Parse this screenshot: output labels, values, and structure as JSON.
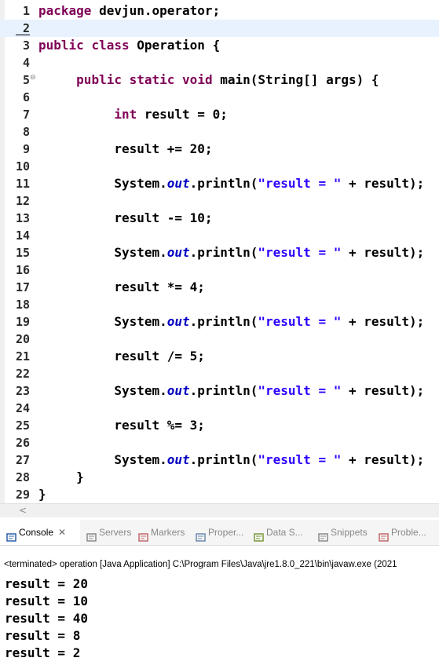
{
  "editor": {
    "lines": [
      {
        "n": "1",
        "parts": [
          {
            "t": "package",
            "c": "kw"
          },
          {
            "t": " devjun.operator;"
          }
        ]
      },
      {
        "n": "2",
        "parts": [],
        "current": true
      },
      {
        "n": "3",
        "parts": [
          {
            "t": "public",
            "c": "kw"
          },
          {
            "t": " "
          },
          {
            "t": "class",
            "c": "kw"
          },
          {
            "t": " Operation {"
          }
        ]
      },
      {
        "n": "4",
        "parts": []
      },
      {
        "n": "5",
        "fold": "⊖",
        "parts": [
          {
            "t": "     "
          },
          {
            "t": "public",
            "c": "kw"
          },
          {
            "t": " "
          },
          {
            "t": "static",
            "c": "kw"
          },
          {
            "t": " "
          },
          {
            "t": "void",
            "c": "kw"
          },
          {
            "t": " main(String[] args) {"
          }
        ]
      },
      {
        "n": "6",
        "parts": []
      },
      {
        "n": "7",
        "parts": [
          {
            "t": "          "
          },
          {
            "t": "int",
            "c": "kw"
          },
          {
            "t": " result = 0;"
          }
        ]
      },
      {
        "n": "8",
        "parts": []
      },
      {
        "n": "9",
        "parts": [
          {
            "t": "          result += 20;"
          }
        ]
      },
      {
        "n": "10",
        "parts": []
      },
      {
        "n": "11",
        "parts": [
          {
            "t": "          System."
          },
          {
            "t": "out",
            "c": "fld"
          },
          {
            "t": ".println("
          },
          {
            "t": "\"result = \"",
            "c": "str"
          },
          {
            "t": " + result);"
          }
        ]
      },
      {
        "n": "12",
        "parts": []
      },
      {
        "n": "13",
        "parts": [
          {
            "t": "          result -= 10;"
          }
        ]
      },
      {
        "n": "14",
        "parts": []
      },
      {
        "n": "15",
        "parts": [
          {
            "t": "          System."
          },
          {
            "t": "out",
            "c": "fld"
          },
          {
            "t": ".println("
          },
          {
            "t": "\"result = \"",
            "c": "str"
          },
          {
            "t": " + result);"
          }
        ]
      },
      {
        "n": "16",
        "parts": []
      },
      {
        "n": "17",
        "parts": [
          {
            "t": "          result *= 4;"
          }
        ]
      },
      {
        "n": "18",
        "parts": []
      },
      {
        "n": "19",
        "parts": [
          {
            "t": "          System."
          },
          {
            "t": "out",
            "c": "fld"
          },
          {
            "t": ".println("
          },
          {
            "t": "\"result = \"",
            "c": "str"
          },
          {
            "t": " + result);"
          }
        ]
      },
      {
        "n": "20",
        "parts": []
      },
      {
        "n": "21",
        "parts": [
          {
            "t": "          result /= 5;"
          }
        ]
      },
      {
        "n": "22",
        "parts": []
      },
      {
        "n": "23",
        "parts": [
          {
            "t": "          System."
          },
          {
            "t": "out",
            "c": "fld"
          },
          {
            "t": ".println("
          },
          {
            "t": "\"result = \"",
            "c": "str"
          },
          {
            "t": " + result);"
          }
        ]
      },
      {
        "n": "24",
        "parts": []
      },
      {
        "n": "25",
        "parts": [
          {
            "t": "          result %= 3;"
          }
        ]
      },
      {
        "n": "26",
        "parts": []
      },
      {
        "n": "27",
        "parts": [
          {
            "t": "          System."
          },
          {
            "t": "out",
            "c": "fld"
          },
          {
            "t": ".println("
          },
          {
            "t": "\"result = \"",
            "c": "str"
          },
          {
            "t": " + result);"
          }
        ]
      },
      {
        "n": "28",
        "parts": [
          {
            "t": "     }"
          }
        ]
      },
      {
        "n": "29",
        "parts": [
          {
            "t": "}"
          }
        ]
      }
    ],
    "scroll_arrow": "<"
  },
  "tabs": [
    {
      "label": "Console",
      "icon": "console-icon",
      "active": true,
      "close": "✕",
      "color": "#2b5fa8"
    },
    {
      "label": "Servers",
      "icon": "servers-icon",
      "color": "#8a8a8a"
    },
    {
      "label": "Markers",
      "icon": "markers-icon",
      "color": "#c46a6a"
    },
    {
      "label": "Proper...",
      "icon": "properties-icon",
      "color": "#6a8ab0"
    },
    {
      "label": "Data S...",
      "icon": "data-source-icon",
      "color": "#7a9a3a"
    },
    {
      "label": "Snippets",
      "icon": "snippets-icon",
      "color": "#8a8a8a"
    },
    {
      "label": "Proble...",
      "icon": "problems-icon",
      "color": "#c46a6a"
    }
  ],
  "console": {
    "status": "<terminated> operation [Java Application] C:\\Program Files\\Java\\jre1.8.0_221\\bin\\javaw.exe (2021",
    "output": [
      "result = 20",
      "result = 10",
      "result = 40",
      "result = 8",
      "result = 2"
    ]
  }
}
